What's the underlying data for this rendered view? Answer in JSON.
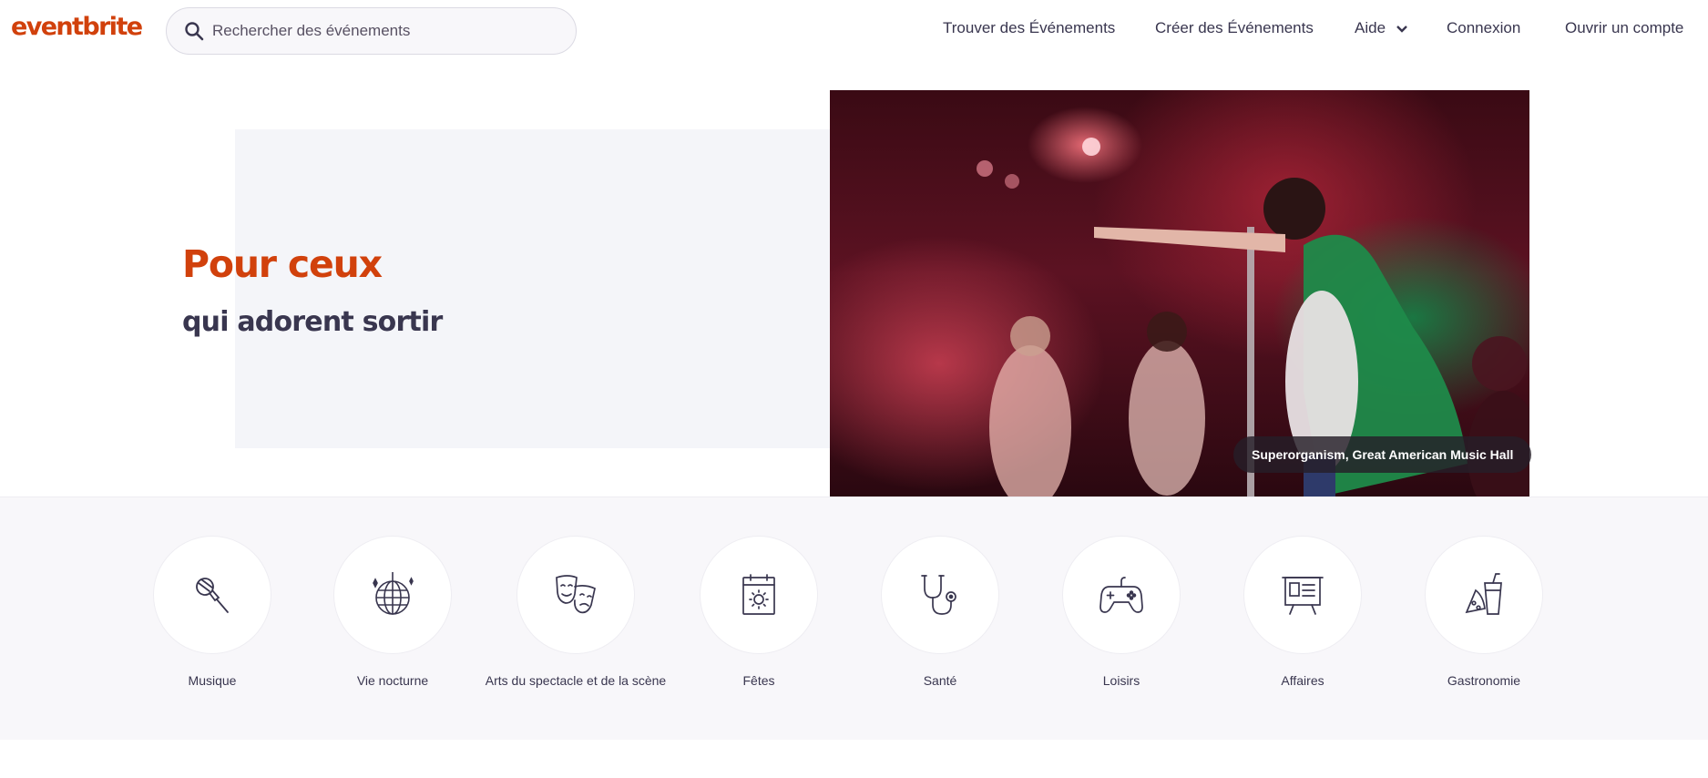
{
  "header": {
    "logo": "eventbrite",
    "search": {
      "placeholder": "Rechercher des événements"
    },
    "nav": {
      "find": "Trouver des Événements",
      "create": "Créer des Événements",
      "help": "Aide",
      "login": "Connexion",
      "signup": "Ouvrir un compte"
    }
  },
  "hero": {
    "title": "Pour ceux",
    "subtitle": "qui adorent sortir",
    "caption": "Superorganism, Great American Music Hall"
  },
  "categories": [
    {
      "label": "Musique",
      "icon": "microphone-icon"
    },
    {
      "label": "Vie nocturne",
      "icon": "disco-ball-icon"
    },
    {
      "label": "Arts du spectacle et de la scène",
      "icon": "theater-masks-icon"
    },
    {
      "label": "Fêtes",
      "icon": "calendar-sun-icon"
    },
    {
      "label": "Santé",
      "icon": "stethoscope-icon"
    },
    {
      "label": "Loisirs",
      "icon": "gamepad-icon"
    },
    {
      "label": "Affaires",
      "icon": "presentation-board-icon"
    },
    {
      "label": "Gastronomie",
      "icon": "food-drink-icon"
    }
  ],
  "colors": {
    "brand": "#d1410c",
    "text": "#39364f",
    "panel": "#f4f5f9",
    "section_bg": "#f8f7fa"
  }
}
